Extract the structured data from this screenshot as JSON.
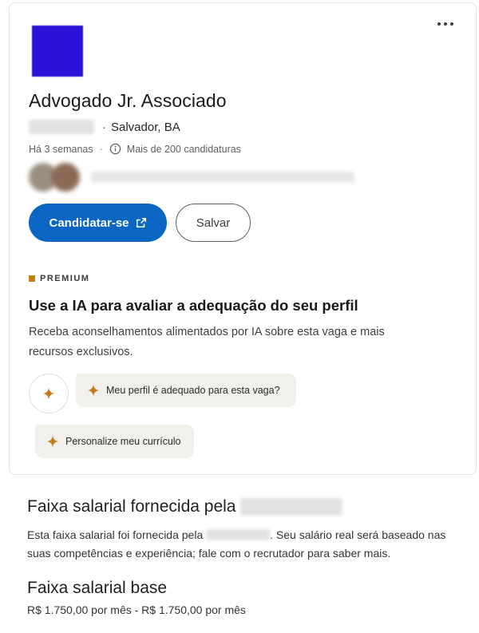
{
  "job_card": {
    "title": "Advogado Jr. Associado",
    "location": "Salvador, BA",
    "posted": "Há 3 semanas",
    "applicants": "Mais de 200 candidaturas",
    "apply_label": "Candidatar-se",
    "save_label": "Salvar",
    "brand_color": "#0a66c2",
    "logo_color": "#2a12d6"
  },
  "premium": {
    "badge": "PREMIUM",
    "title": "Use a IA para avaliar a adequação do seu perfil",
    "description": "Receba aconselhamentos alimentados por IA sobre esta vaga e mais recursos exclusivos.",
    "chips": [
      {
        "label": "Meu perfil é adequado para esta vaga?"
      },
      {
        "label": "Personalize meu currículo"
      }
    ],
    "accent_color": "#c37d16"
  },
  "salary": {
    "title_prefix": "Faixa salarial fornecida pela",
    "desc_prefix": "Esta faixa salarial foi fornecida pela",
    "desc_suffix": ". Seu salário real será baseado nas suas competências e experiência; fale com o recrutador para saber mais.",
    "base_title": "Faixa salarial base",
    "base_value": "R$ 1.750,00 por mês - R$ 1.750,00 por mês"
  }
}
